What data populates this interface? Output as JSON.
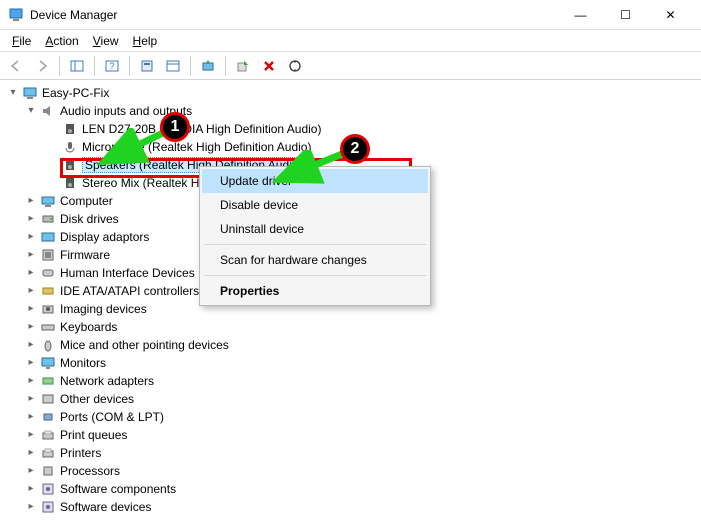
{
  "window": {
    "title": "Device Manager"
  },
  "menu": {
    "file": "File",
    "action": "Action",
    "view": "View",
    "help": "Help"
  },
  "tree": {
    "root": "Easy-PC-Fix",
    "audio_cat": "Audio inputs and outputs",
    "audio_children": {
      "lenovo": "LEN D27-20B (NVIDIA High Definition Audio)",
      "mic": "Microphone (Realtek High Definition Audio)",
      "speakers": "Speakers (Realtek High Definition Audio)",
      "stereo": "Stereo Mix (Realtek High Definition Audio)"
    },
    "categories": [
      "Computer",
      "Disk drives",
      "Display adaptors",
      "Firmware",
      "Human Interface Devices",
      "IDE ATA/ATAPI controllers",
      "Imaging devices",
      "Keyboards",
      "Mice and other pointing devices",
      "Monitors",
      "Network adapters",
      "Other devices",
      "Ports (COM & LPT)",
      "Print queues",
      "Printers",
      "Processors",
      "Software components",
      "Software devices"
    ]
  },
  "context_menu": {
    "update": "Update driver",
    "disable": "Disable device",
    "uninstall": "Uninstall device",
    "scan": "Scan for hardware changes",
    "properties": "Properties"
  },
  "annotations": {
    "badge1": "1",
    "badge2": "2"
  },
  "colors": {
    "highlight_border": "#e10000",
    "selection_bg": "#cde8ff",
    "ctx_hover": "#bfe3ff",
    "arrow": "#21d321"
  }
}
